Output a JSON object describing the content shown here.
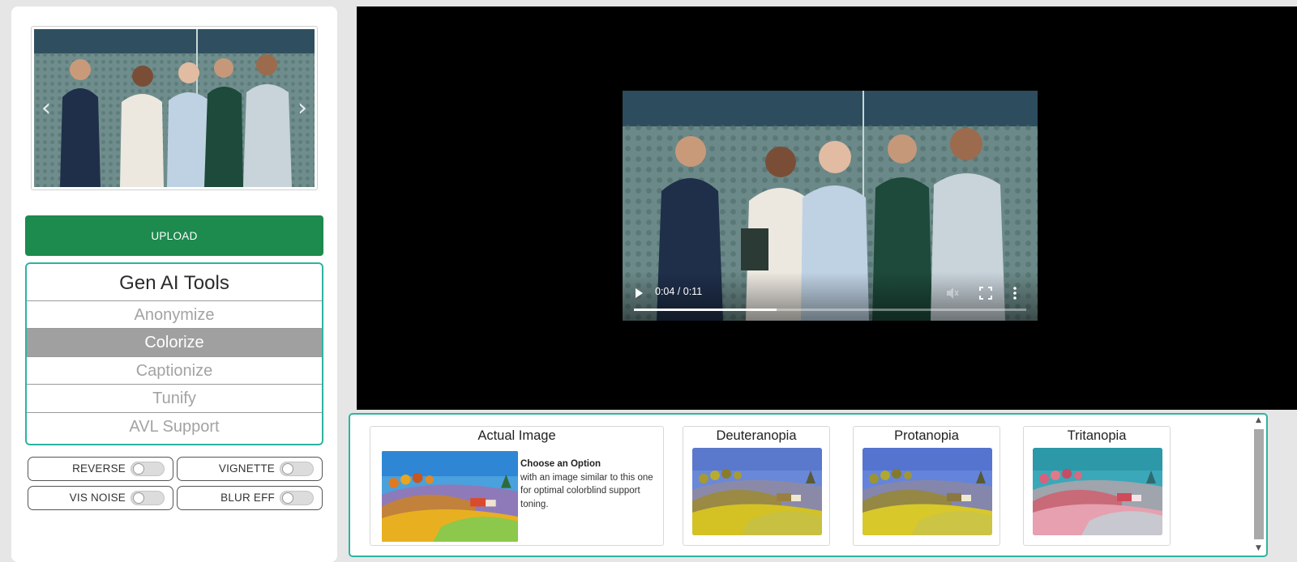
{
  "sidebar": {
    "upload_label": "UPLOAD",
    "tools_title": "Gen AI Tools",
    "tools": [
      {
        "label": "Anonymize",
        "active": false
      },
      {
        "label": "Colorize",
        "active": true
      },
      {
        "label": "Captionize",
        "active": false
      },
      {
        "label": "Tunify",
        "active": false
      },
      {
        "label": "AVL Support",
        "active": false
      }
    ],
    "toggles": [
      {
        "label": "REVERSE",
        "on": false
      },
      {
        "label": "VIGNETTE",
        "on": false
      },
      {
        "label": "VIS NOISE",
        "on": false
      },
      {
        "label": "BLUR EFF",
        "on": false
      }
    ],
    "carousel": {
      "prev_icon": "chevron-left-icon",
      "next_icon": "chevron-right-icon"
    }
  },
  "video": {
    "time": "0:04 / 0:11",
    "progress": 0.364,
    "icons": [
      "play-icon",
      "volume-muted-icon",
      "fullscreen-icon",
      "more-vertical-icon"
    ]
  },
  "colorblind": {
    "actual": {
      "title": "Actual Image",
      "desc_title": "Choose an Option",
      "desc_body": "with an image similar to this one for optimal colorblind support toning."
    },
    "options": [
      {
        "title": "Deuteranopia"
      },
      {
        "title": "Protanopia"
      },
      {
        "title": "Tritanopia"
      }
    ]
  },
  "colors": {
    "accent_green": "#1d8a4e",
    "teal_border": "#2fb3a0",
    "active_tool_bg": "#a0a0a0"
  }
}
